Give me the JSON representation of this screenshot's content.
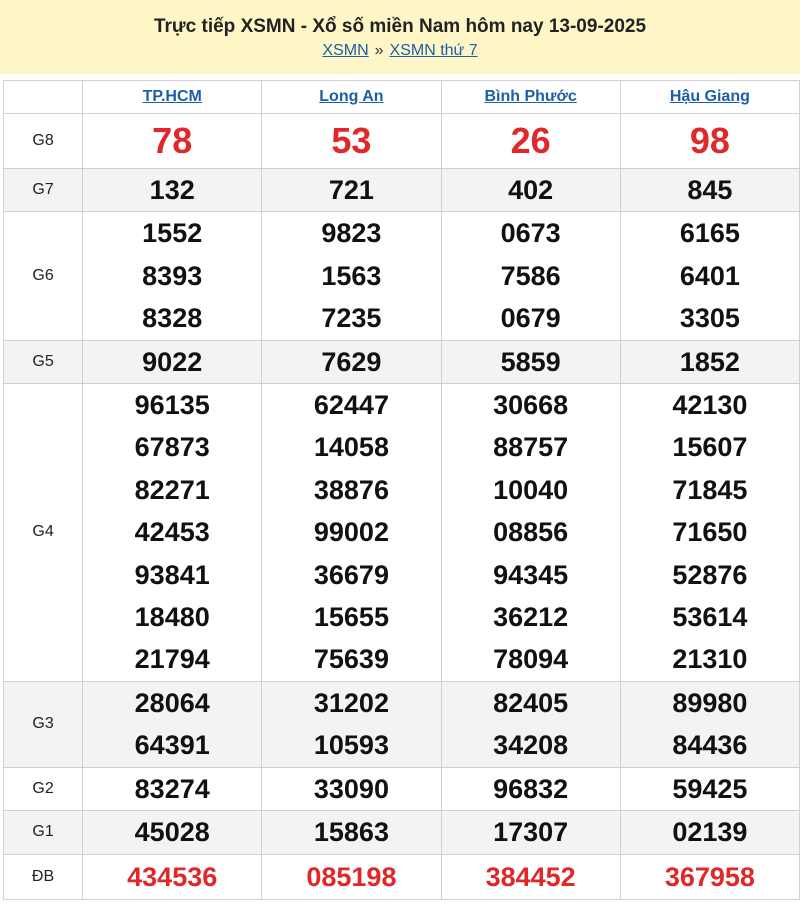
{
  "header": {
    "title": "Trực tiếp XSMN - Xổ số miền Nam hôm nay 13-09-2025",
    "crumb_1": "XSMN",
    "crumb_sep": "»",
    "crumb_2": "XSMN thứ 7"
  },
  "provinces": [
    "TP.HCM",
    "Long An",
    "Bình Phước",
    "Hậu Giang"
  ],
  "rows": [
    {
      "prize": "G8",
      "values": [
        [
          "78"
        ],
        [
          "53"
        ],
        [
          "26"
        ],
        [
          "98"
        ]
      ]
    },
    {
      "prize": "G7",
      "values": [
        [
          "132"
        ],
        [
          "721"
        ],
        [
          "402"
        ],
        [
          "845"
        ]
      ]
    },
    {
      "prize": "G6",
      "values": [
        [
          "1552",
          "8393",
          "8328"
        ],
        [
          "9823",
          "1563",
          "7235"
        ],
        [
          "0673",
          "7586",
          "0679"
        ],
        [
          "6165",
          "6401",
          "3305"
        ]
      ]
    },
    {
      "prize": "G5",
      "values": [
        [
          "9022"
        ],
        [
          "7629"
        ],
        [
          "5859"
        ],
        [
          "1852"
        ]
      ]
    },
    {
      "prize": "G4",
      "values": [
        [
          "96135",
          "67873",
          "82271",
          "42453",
          "93841",
          "18480",
          "21794"
        ],
        [
          "62447",
          "14058",
          "38876",
          "99002",
          "36679",
          "15655",
          "75639"
        ],
        [
          "30668",
          "88757",
          "10040",
          "08856",
          "94345",
          "36212",
          "78094"
        ],
        [
          "42130",
          "15607",
          "71845",
          "71650",
          "52876",
          "53614",
          "21310"
        ]
      ]
    },
    {
      "prize": "G3",
      "values": [
        [
          "28064",
          "64391"
        ],
        [
          "31202",
          "10593"
        ],
        [
          "82405",
          "34208"
        ],
        [
          "89980",
          "84436"
        ]
      ]
    },
    {
      "prize": "G2",
      "values": [
        [
          "83274"
        ],
        [
          "33090"
        ],
        [
          "96832"
        ],
        [
          "59425"
        ]
      ]
    },
    {
      "prize": "G1",
      "values": [
        [
          "45028"
        ],
        [
          "15863"
        ],
        [
          "17307"
        ],
        [
          "02139"
        ]
      ]
    },
    {
      "prize": "ĐB",
      "values": [
        [
          "434536"
        ],
        [
          "085198"
        ],
        [
          "384452"
        ],
        [
          "367958"
        ]
      ]
    }
  ],
  "colors": {
    "header_bg": "#fff6c7",
    "link": "#1a5fa8",
    "highlight": "#e0282a",
    "alt_row": "#f3f3f3"
  }
}
